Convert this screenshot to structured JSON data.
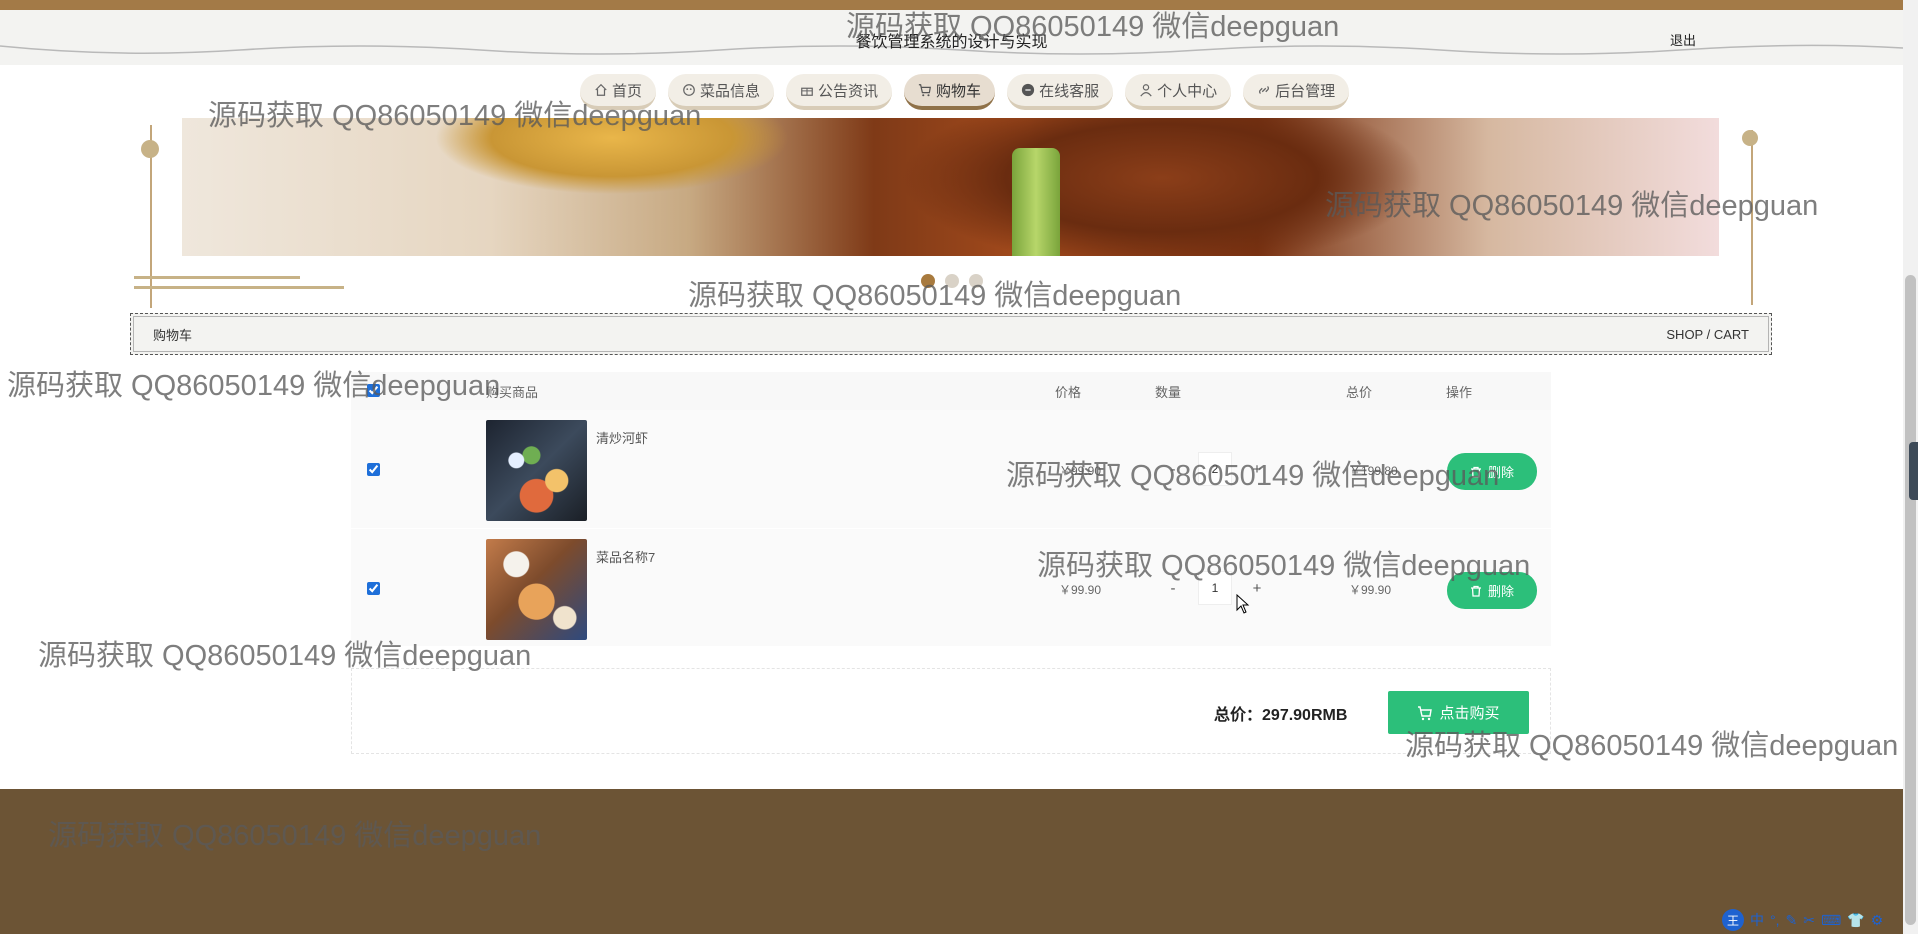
{
  "header": {
    "site_title": "餐饮管理系统的设计与实现",
    "logout_label": "退出"
  },
  "nav": {
    "items": [
      {
        "label": "首页",
        "icon": "home-icon"
      },
      {
        "label": "菜品信息",
        "icon": "dish-icon"
      },
      {
        "label": "公告资讯",
        "icon": "gift-icon"
      },
      {
        "label": "购物车",
        "icon": "cart-icon",
        "active": true
      },
      {
        "label": "在线客服",
        "icon": "chat-icon"
      },
      {
        "label": "个人中心",
        "icon": "user-icon"
      },
      {
        "label": "后台管理",
        "icon": "link-icon"
      }
    ]
  },
  "banner": {
    "slide_count": 3,
    "active_slide": 1
  },
  "breadcrumb": {
    "left": "购物车",
    "right": "SHOP / CART"
  },
  "cart": {
    "headers": {
      "product": "购买商品",
      "price": "价格",
      "quantity": "数量",
      "total": "总价",
      "action": "操作"
    },
    "items": [
      {
        "name": "清炒河虾",
        "price": "￥99.90",
        "quantity": "2",
        "total": "￥199.80",
        "checked": true,
        "delete_label": "删除"
      },
      {
        "name": "菜品名称7",
        "price": "￥99.90",
        "quantity": "1",
        "total": "￥99.90",
        "checked": true,
        "delete_label": "删除"
      }
    ],
    "minus_label": "-",
    "plus_label": "+",
    "summary_label": "总价：",
    "summary_value": "297.90RMB",
    "buy_label": "点击购买"
  },
  "watermark": "源码获取 QQ86050149 微信deepguan",
  "ime": {
    "badge": "王",
    "mode": "中"
  },
  "colors": {
    "accent_green": "#2cbf7a",
    "brand_brown": "#a37a47",
    "footer_brown": "#6c5435"
  }
}
